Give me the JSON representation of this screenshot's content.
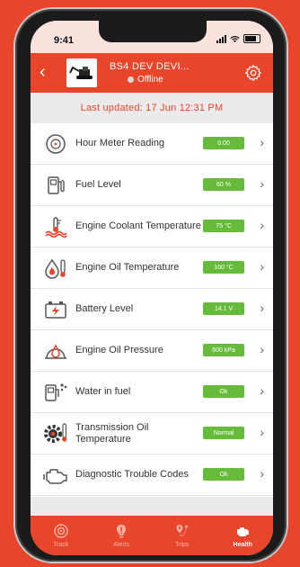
{
  "statusbar": {
    "time": "9:41"
  },
  "header": {
    "title": "BS4 DEV DEVI...",
    "status": "Offline",
    "accent": "#e8452a"
  },
  "last_updated": "Last updated: 17 Jun 12:31 PM",
  "rows": [
    {
      "label": "Hour Meter Reading",
      "value": "0.00",
      "icon": "clock-icon"
    },
    {
      "label": "Fuel Level",
      "value": "60 %",
      "icon": "fuel-pump-icon"
    },
    {
      "label": "Engine Coolant Temperature",
      "value": "75 °C",
      "icon": "coolant-temperature-icon"
    },
    {
      "label": "Engine Oil Temperature",
      "value": "100 °C",
      "icon": "oil-temperature-icon"
    },
    {
      "label": "Battery Level",
      "value": "14.1 V",
      "icon": "battery-icon"
    },
    {
      "label": "Engine Oil Pressure",
      "value": "600 kPa",
      "icon": "oil-pressure-icon"
    },
    {
      "label": "Water in fuel",
      "value": "Ok",
      "icon": "water-in-fuel-icon"
    },
    {
      "label": "Transmission Oil Temperature",
      "value": "Normal",
      "icon": "transmission-icon"
    },
    {
      "label": "Diagnostic Trouble Codes",
      "value": "Ok",
      "icon": "engine-icon"
    }
  ],
  "tabs": [
    {
      "label": "Track",
      "icon": "track-icon"
    },
    {
      "label": "Alerts",
      "icon": "alert-icon"
    },
    {
      "label": "Trips",
      "icon": "trips-icon"
    },
    {
      "label": "Health",
      "icon": "health-icon",
      "active": true
    }
  ],
  "badge_color": "#66bb3a"
}
